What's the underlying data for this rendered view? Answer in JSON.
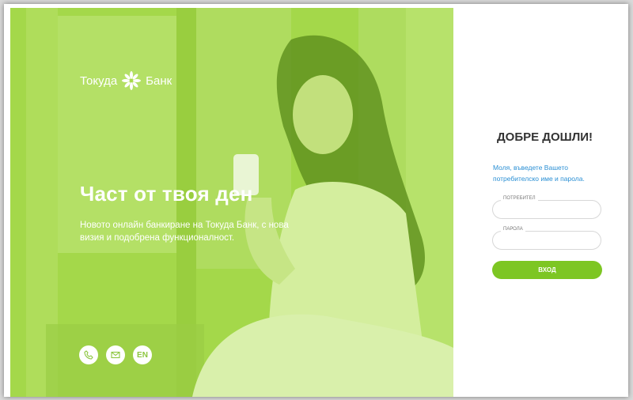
{
  "brand": {
    "name_left": "Токуда",
    "name_right": "Банк"
  },
  "hero": {
    "headline": "Част от твоя ден",
    "subtext": "Новото онлайн банкиране на Токуда Банк, с нова визия и подобрена функционалност."
  },
  "contact": {
    "phone_icon": "phone-icon",
    "mail_icon": "mail-icon",
    "language_label": "EN"
  },
  "login": {
    "title": "ДОБРЕ ДОШЛИ!",
    "prompt": "Моля, въведете Вашето потребителско име и парола.",
    "username_label": "ПОТРЕБИТЕЛ",
    "username_value": "",
    "password_label": "ПАРОЛА",
    "password_value": "",
    "submit_label": "ВХОД"
  },
  "colors": {
    "accent_green": "#7dc623",
    "hero_overlay": "#a7d94a",
    "link_blue": "#2a8fd4"
  }
}
